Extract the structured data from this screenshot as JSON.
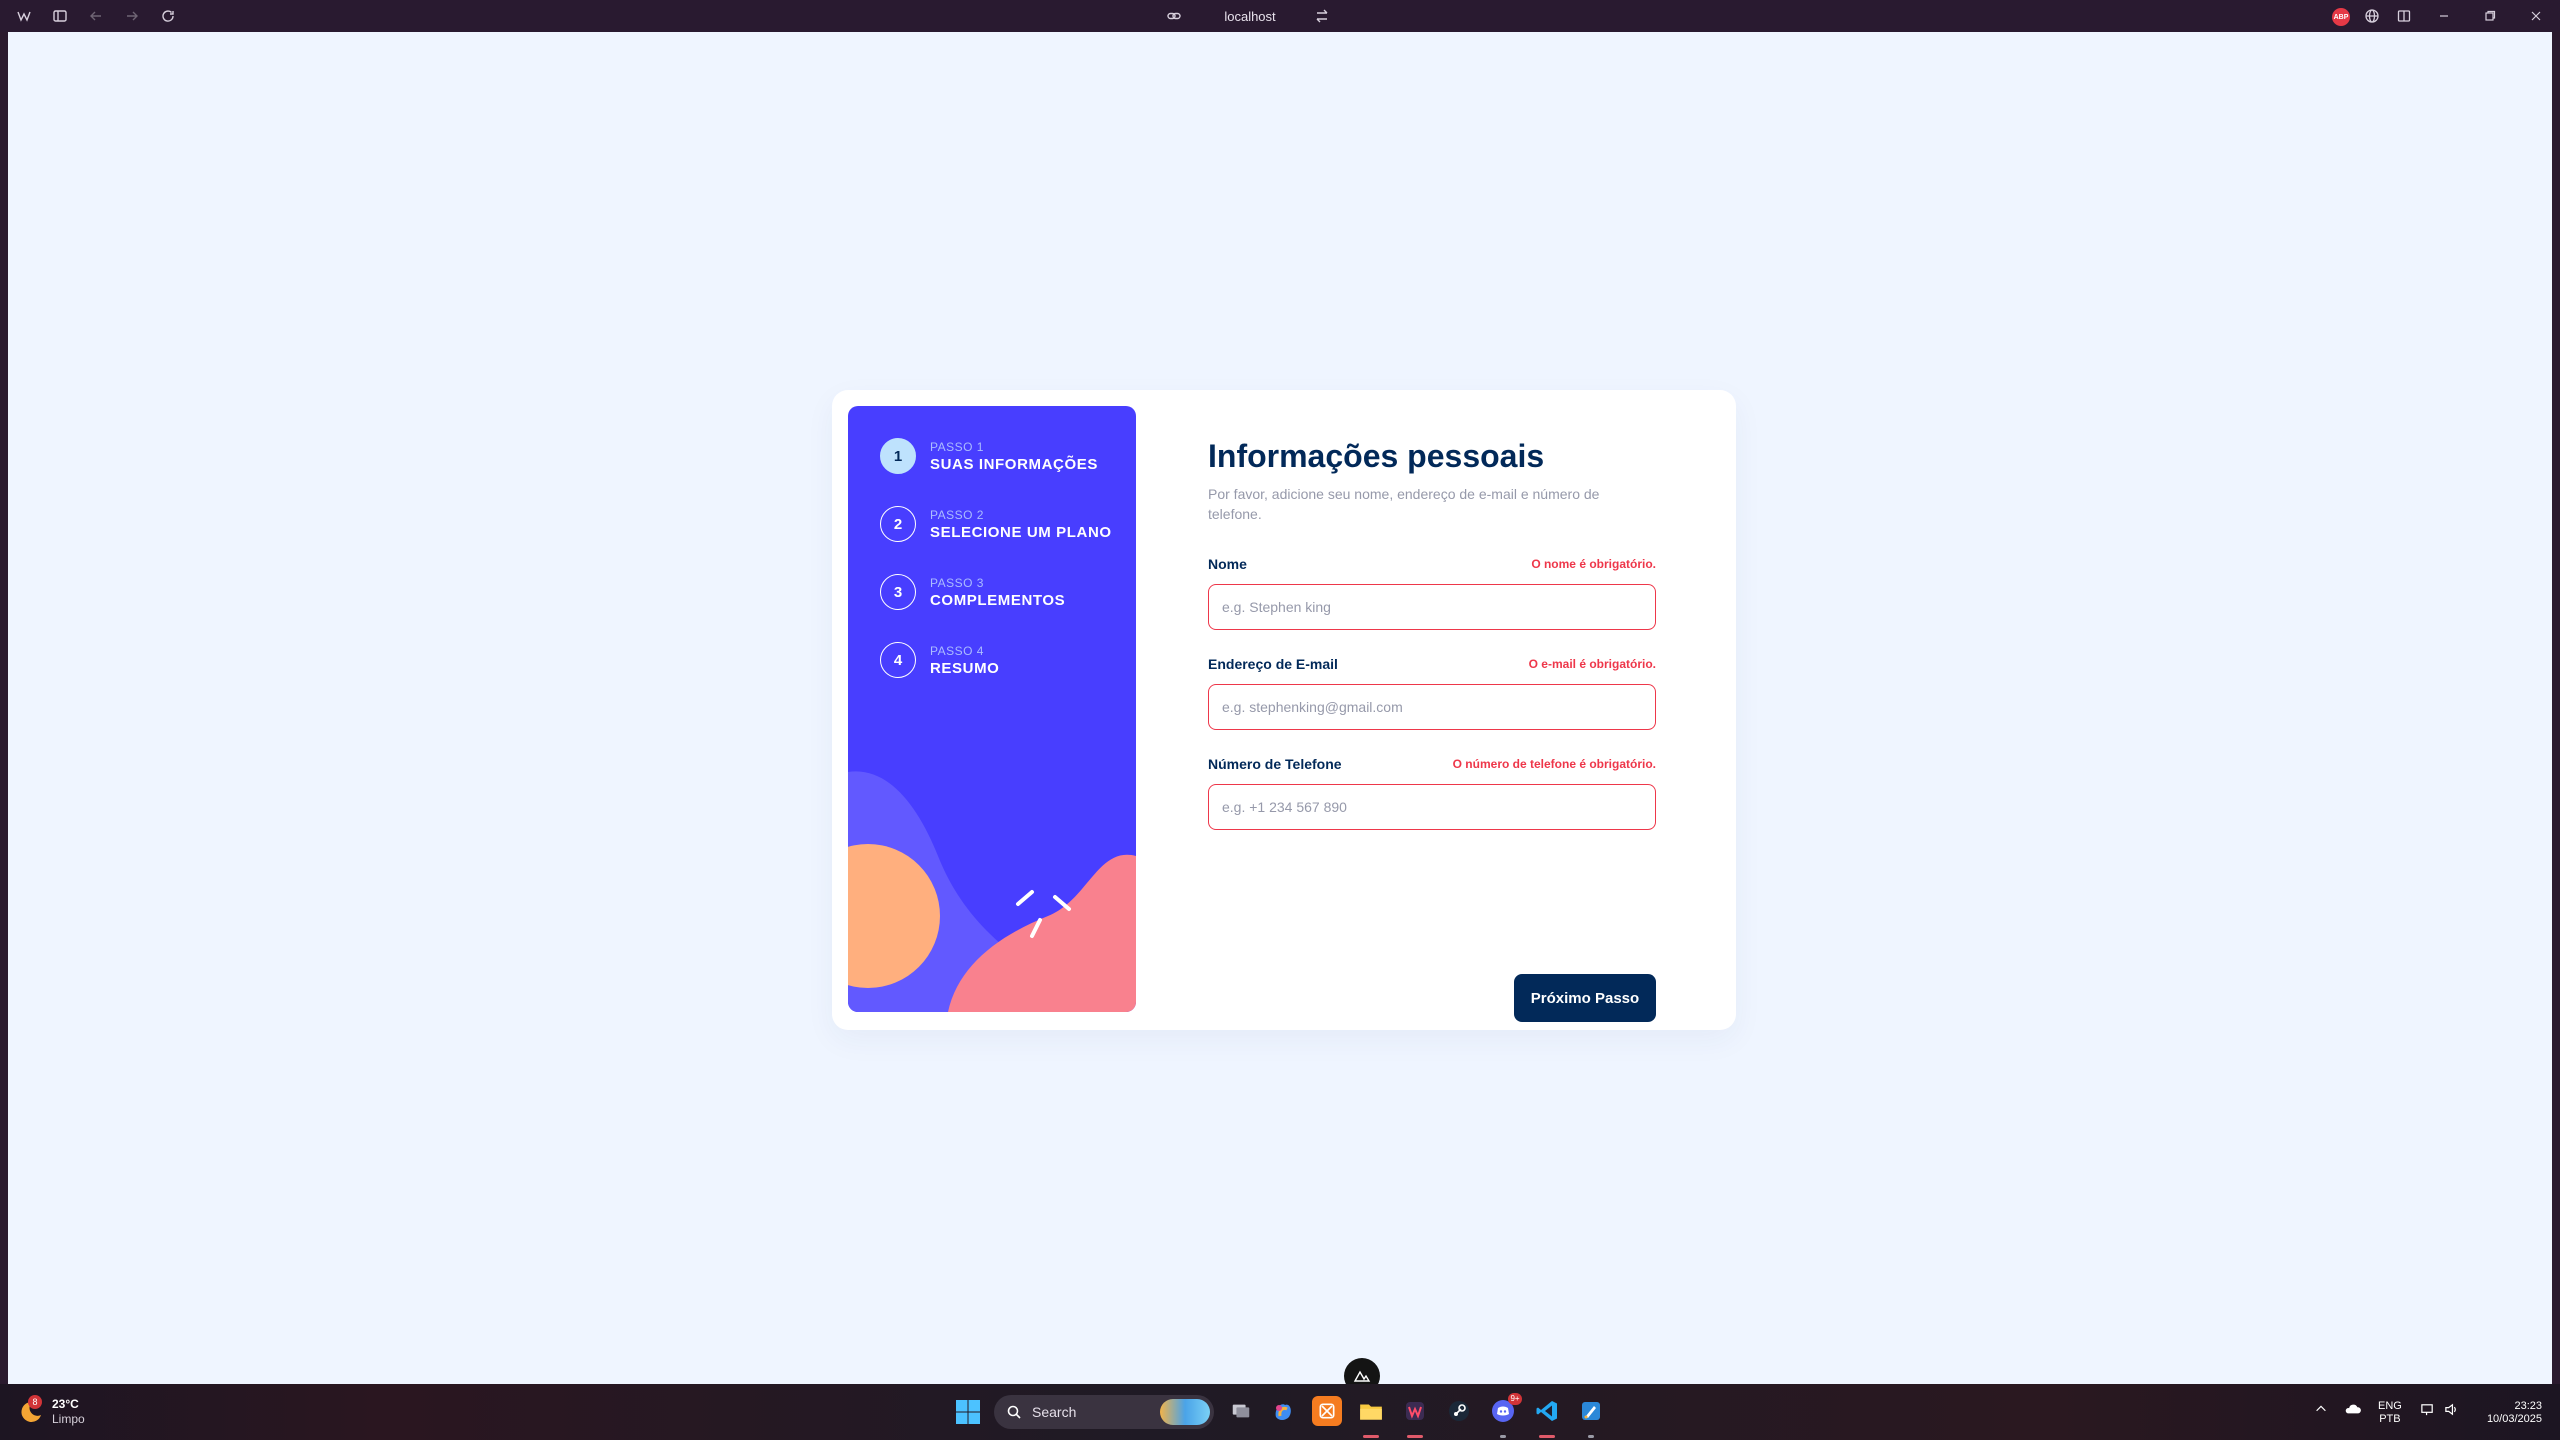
{
  "browser": {
    "address": "localhost",
    "extension_badge": "ABP",
    "icons": [
      "app-menu-icon",
      "sidebar-toggle-icon",
      "back-icon",
      "forward-icon",
      "reload-icon",
      "link-icon",
      "swap-icon",
      "globe-icon",
      "split-view-icon",
      "minimize-icon",
      "restore-icon",
      "close-icon"
    ]
  },
  "sidebar": {
    "steps": [
      {
        "number": "1",
        "label": "PASSO 1",
        "title": "SUAS INFORMAÇÕES",
        "active": true
      },
      {
        "number": "2",
        "label": "PASSO 2",
        "title": "SELECIONE UM PLANO",
        "active": false
      },
      {
        "number": "3",
        "label": "PASSO 3",
        "title": "COMPLEMENTOS",
        "active": false
      },
      {
        "number": "4",
        "label": "PASSO 4",
        "title": "RESUMO",
        "active": false
      }
    ]
  },
  "form": {
    "title": "Informações pessoais",
    "subtitle": "Por favor, adicione seu nome, endereço de e-mail e número de telefone.",
    "fields": [
      {
        "label": "Nome",
        "error": "O nome é obrigatório.",
        "placeholder": "e.g. Stephen king",
        "value": ""
      },
      {
        "label": "Endereço de E-mail",
        "error": "O e-mail é obrigatório.",
        "placeholder": "e.g. stephenking@gmail.com",
        "value": ""
      },
      {
        "label": "Número de Telefone",
        "error": "O número de telefone é obrigatório.",
        "placeholder": "e.g. +1 234 567 890",
        "value": ""
      }
    ],
    "next_button": "Próximo Passo"
  },
  "colors": {
    "sidebar": "#483eff",
    "primary": "#022959",
    "error": "#ee374a",
    "active_step": "#bee2fd",
    "page_bg": "#eff5ff"
  },
  "taskbar": {
    "weather": {
      "temp": "23°C",
      "desc": "Limpo",
      "badge": "8"
    },
    "search_label": "Search",
    "apps": [
      "windows-start-icon",
      "task-view-icon",
      "copilot-icon",
      "xampp-icon",
      "file-explorer-icon",
      "browser-icon",
      "steam-icon",
      "discord-icon",
      "vscode-icon",
      "paint-icon"
    ],
    "discord_badge": "9+",
    "lang_top": "ENG",
    "lang_bottom": "PTB",
    "time": "23:23",
    "date": "10/03/2025"
  }
}
